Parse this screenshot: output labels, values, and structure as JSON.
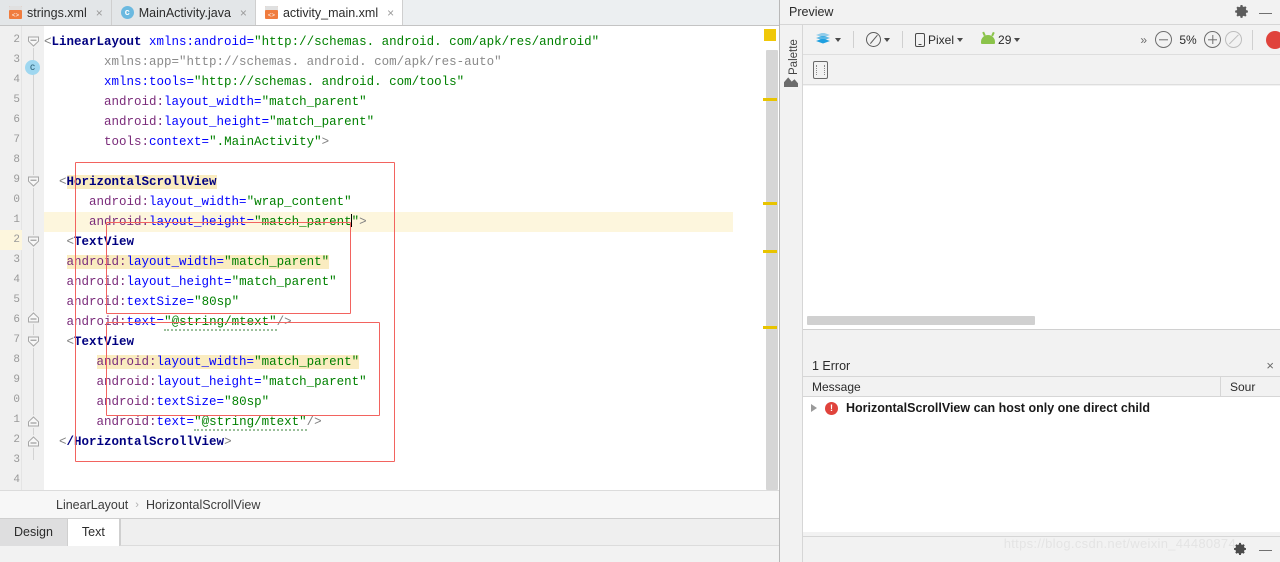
{
  "editor": {
    "tabs": [
      {
        "label": "strings.xml",
        "icon": "xml-file-icon",
        "active": false
      },
      {
        "label": "MainActivity.java",
        "icon": "java-file-icon",
        "active": false
      },
      {
        "label": "activity_main.xml",
        "icon": "xml-file-icon",
        "active": true
      }
    ],
    "close_glyph": "×",
    "line_numbers": [
      "2",
      "3",
      "4",
      "5",
      "6",
      "7",
      "8",
      "9",
      "0",
      "1",
      "2",
      "3",
      "4",
      "5",
      "6",
      "7",
      "8",
      "9",
      "0",
      "1",
      "2",
      "3",
      "4"
    ],
    "highlighted_line_index": 10,
    "breadcrumb": {
      "items": [
        "LinearLayout",
        "HorizontalScrollView"
      ],
      "separator": "›"
    },
    "bottom_tabs": [
      {
        "label": "Design",
        "active": false
      },
      {
        "label": "Text",
        "active": true
      }
    ],
    "code": {
      "l2": {
        "tag": "LinearLayout",
        "attr_name": "xmlns:android",
        "value": "\"http://schemas. android. com/apk/res/android\""
      },
      "l3": {
        "attr_name": "xmlns:app",
        "value": "\"http://schemas. android. com/apk/res-auto\""
      },
      "l4": {
        "attr_name": "xmlns:tools",
        "value": "\"http://schemas. android. com/tools\""
      },
      "l5": {
        "prefix": "android:",
        "attr_name": "layout_width",
        "value": "\"match_parent\""
      },
      "l6": {
        "prefix": "android:",
        "attr_name": "layout_height",
        "value": "\"match_parent\""
      },
      "l7": {
        "prefix": "tools:",
        "attr_name": "context",
        "value": "\".MainActivity\"",
        "close": ">"
      },
      "l9": {
        "tag": "HorizontalScrollView"
      },
      "l10": {
        "prefix": "android:",
        "attr_name": "layout_width",
        "value": "\"wrap_content\""
      },
      "l11": {
        "prefix": "android:",
        "attr_name": "layout_height",
        "value": "\"match_parent",
        "value_tail": "\"",
        "close": ">"
      },
      "l12": {
        "tag": "TextView"
      },
      "l13": {
        "prefix": "android:",
        "attr_name": "layout_width",
        "value": "\"match_parent\""
      },
      "l14": {
        "prefix": "android:",
        "attr_name": "layout_height",
        "value": "\"match_parent\""
      },
      "l15": {
        "prefix": "android:",
        "attr_name": "textSize",
        "value": "\"80sp\""
      },
      "l16": {
        "prefix": "android:",
        "attr_name": "text",
        "value": "\"@string/mtext\"",
        "close": "/>"
      },
      "l17": {
        "tag": "TextView"
      },
      "l18": {
        "prefix": "android:",
        "attr_name": "layout_width",
        "value": "\"match_parent\""
      },
      "l19": {
        "prefix": "android:",
        "attr_name": "layout_height",
        "value": "\"match_parent\""
      },
      "l20": {
        "prefix": "android:",
        "attr_name": "textSize",
        "value": "\"80sp\""
      },
      "l21": {
        "prefix": "android:",
        "attr_name": "text",
        "value": "\"@string/mtext\"",
        "close": "/>"
      },
      "l22": {
        "tag": "/HorizontalScrollView"
      }
    }
  },
  "preview": {
    "title": "Preview",
    "palette_label": "Palette",
    "toolbar": {
      "device_label": "Pixel",
      "api_label": "29",
      "zoom_label": "5%",
      "overflow_glyph": "»"
    }
  },
  "errors": {
    "count_label": "1 Error",
    "close_glyph": "×",
    "columns": {
      "message": "Message",
      "source": "Sour"
    },
    "rows": [
      {
        "message": "HorizontalScrollView can host only one direct child"
      }
    ]
  },
  "status": {
    "watermark": "https://blog.csdn.net/weixin_44480874"
  }
}
